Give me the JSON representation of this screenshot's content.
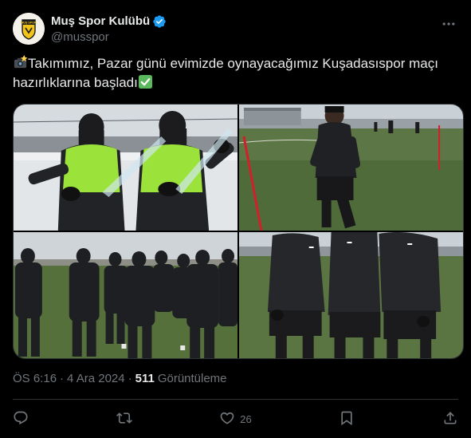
{
  "account": {
    "display_name": "Muş Spor Kulübü",
    "handle": "@musspor",
    "avatar_text": "MUŞ SPOR"
  },
  "tweet": {
    "text": "Takımımız, Pazar günü evimizde oynayacağımız Kuşadasıspor maçı hazırlıklarına başladı",
    "leading_emoji": "camera-flash-emoji",
    "trailing_emoji": "check-mark-button-emoji"
  },
  "media": {
    "photos": [
      {
        "name": "photo-two-players-snow-vests"
      },
      {
        "name": "photo-player-running-pitch"
      },
      {
        "name": "photo-team-jogging-group"
      },
      {
        "name": "photo-three-players-jackets"
      }
    ]
  },
  "meta": {
    "time": "ÖS 6:16",
    "separator": "·",
    "date": "4 Ara 2024",
    "views_count": "511",
    "views_label": "Görüntüleme"
  },
  "actions": {
    "reply_count": "",
    "retweet_count": "",
    "like_count": "26",
    "bookmark_count": "",
    "share_count": ""
  },
  "colors": {
    "background": "#000000",
    "text": "#e7e9ea",
    "secondary": "#71767b",
    "verified": "#1d9bf0",
    "border": "#2f3336",
    "vest_green": "#9be33a"
  }
}
